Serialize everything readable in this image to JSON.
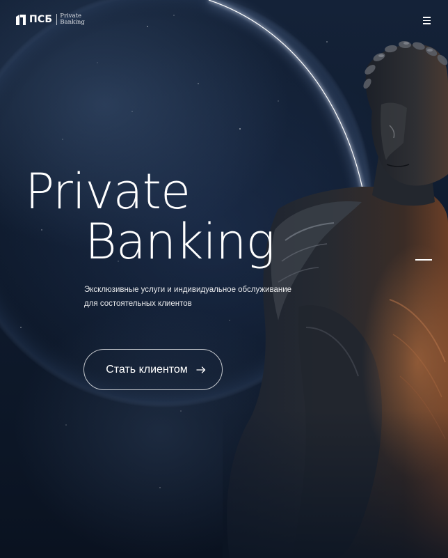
{
  "header": {
    "logo_abbr": "ПСБ",
    "logo_sub_line1": "Private",
    "logo_sub_line2": "Banking",
    "menu_icon": "hamburger-menu-icon"
  },
  "hero": {
    "title_line1": "Private",
    "title_line2": "Banking",
    "subtitle_line1": "Эксклюзивные услуги и индивидуальное обслуживание",
    "subtitle_line2": "для состоятельных клиентов",
    "cta_label": "Стать клиентом",
    "cta_icon": "arrow-right-icon"
  },
  "decor": {
    "background": "night-sky-with-planet-arc",
    "statue": "roman-emperor-bronze-statue",
    "side_indicator": "slide-indicator-dash"
  },
  "colors": {
    "background": "#0f1b2e",
    "text": "#ffffff",
    "planet_glow": "#dfe9ff",
    "statue_highlight": "#b8744a"
  }
}
